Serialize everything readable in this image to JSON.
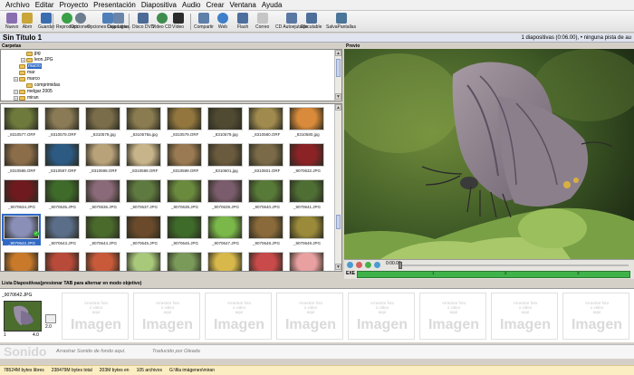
{
  "menu": [
    "Archivo",
    "Editar",
    "Proyecto",
    "Presentación",
    "Diapositiva",
    "Audio",
    "Crear",
    "Ventana",
    "Ayuda"
  ],
  "toolbar": [
    {
      "label": "Nuevo",
      "icon": "new-icon",
      "color": "#8a6fb0"
    },
    {
      "label": "Abrir",
      "icon": "open-icon",
      "color": "#c9a53a"
    },
    {
      "label": "Guardar",
      "icon": "save-icon",
      "color": "#3a6db0"
    },
    {
      "label": "Reproducir",
      "icon": "play-icon",
      "color": "#3aa047"
    },
    {
      "label": "Opciones",
      "icon": "options-icon",
      "color": "#6c7d8f"
    },
    {
      "label": "Opciones Diapositiva",
      "icon": "slide-options-icon",
      "color": "#4f7fb8"
    },
    {
      "label": "Caja Ligera",
      "icon": "lightbox-icon",
      "color": "#6a85a8"
    },
    {
      "label": "Disco DVD",
      "icon": "dvd-icon",
      "color": "#4c6a96"
    },
    {
      "label": "Video CD",
      "icon": "vcd-icon",
      "color": "#3e8d4f"
    },
    {
      "label": "Vídeo",
      "icon": "video-icon",
      "color": "#2b2b2b"
    },
    {
      "label": "Compartir",
      "icon": "share-icon",
      "color": "#5d7faa"
    },
    {
      "label": "Web",
      "icon": "web-icon",
      "color": "#3d7fc9"
    },
    {
      "label": "Flash",
      "icon": "flash-icon",
      "color": "#4d6f9e"
    },
    {
      "label": "Correo",
      "icon": "mail-icon",
      "color": "#c5c5c5"
    },
    {
      "label": "CD Autoejutable",
      "icon": "autorun-cd-icon",
      "color": "#5a78a3"
    },
    {
      "label": "Ejecutable",
      "icon": "executable-icon",
      "color": "#4e6f99"
    },
    {
      "label": "SalvaPantallas",
      "icon": "screensaver-icon",
      "color": "#4b7599"
    }
  ],
  "project": {
    "title": "Sin Título 1",
    "info": "1 diapositivas (0:06.00), • ninguna pista de au"
  },
  "panels": {
    "folders": "Carpetas",
    "preview": "Previo",
    "slide_list": "Lista Diapositivas(presionar TAB para alternar en modo objetivo)"
  },
  "folder_tree": [
    {
      "label": "jpg",
      "indent": 2,
      "expander": ""
    },
    {
      "label": "leon.JPG",
      "indent": 2,
      "expander": "+"
    },
    {
      "label": "macro",
      "indent": 1,
      "expander": "",
      "selected": true
    },
    {
      "label": "mar",
      "indent": 1,
      "expander": ""
    },
    {
      "label": "marco",
      "indent": 1,
      "expander": "+"
    },
    {
      "label": "comprimidas",
      "indent": 2,
      "expander": ""
    },
    {
      "label": "melgar 2005",
      "indent": 1,
      "expander": "+"
    },
    {
      "label": "miran",
      "indent": 1,
      "expander": "+"
    }
  ],
  "thumbnails": [
    {
      "name": "_8310577.ORF",
      "color": "#6d7a3c"
    },
    {
      "name": "_8310578.ORF",
      "color": "#8a7a55"
    },
    {
      "name": "_8310578.jpg",
      "color": "#7a6d4a"
    },
    {
      "name": "_8310578a.jpg",
      "color": "#8a7c50"
    },
    {
      "name": "_8310579.ORF",
      "color": "#92763e"
    },
    {
      "name": "_8310579.jpg",
      "color": "#504a32"
    },
    {
      "name": "_8310580.ORF",
      "color": "#a08a4e"
    },
    {
      "name": "_8310580.jpg",
      "color": "#d98a3a"
    },
    {
      "name": "_8310586.ORF",
      "color": "#8c6d4a"
    },
    {
      "name": "_8310597.ORF",
      "color": "#2c5a82"
    },
    {
      "name": "_8310598.ORF",
      "color": "#b8a27a"
    },
    {
      "name": "_8310598.ORF",
      "color": "#c8b48a"
    },
    {
      "name": "_8310599.ORF",
      "color": "#9a7a52"
    },
    {
      "name": "_8310601.jpg",
      "color": "#6a5a3e"
    },
    {
      "name": "_8310601.ORF",
      "color": "#7a6a48"
    },
    {
      "name": "_9070632.JPG",
      "color": "#8a2226"
    },
    {
      "name": "_9070634.JPG",
      "color": "#6e1a1e"
    },
    {
      "name": "_9070635.JPG",
      "color": "#3e6b2a"
    },
    {
      "name": "_9070636.JPG",
      "color": "#8a6a78"
    },
    {
      "name": "_9070637.JPG",
      "color": "#5f7a40"
    },
    {
      "name": "_9070638.JPG",
      "color": "#6a8a3e"
    },
    {
      "name": "_9070639.JPG",
      "color": "#7a5c6c"
    },
    {
      "name": "_9070640.JPG",
      "color": "#587a38"
    },
    {
      "name": "_9070641.JPG",
      "color": "#4e6e34"
    },
    {
      "name": "_9070642.JPG",
      "color": "#8a8fb8",
      "selected": true
    },
    {
      "name": "_9070643.JPG",
      "color": "#5a6e8a"
    },
    {
      "name": "_9070644.JPG",
      "color": "#4a6a2c"
    },
    {
      "name": "_9070645.JPG",
      "color": "#6a4a2a"
    },
    {
      "name": "_9070646.JPG",
      "color": "#3e6a2a"
    },
    {
      "name": "_9070647.JPG",
      "color": "#7ab84a"
    },
    {
      "name": "_9070648.JPG",
      "color": "#8a6a3a"
    },
    {
      "name": "_9070649.JPG",
      "color": "#9a8a3a"
    },
    {
      "name": "",
      "color": "#c87a2a"
    },
    {
      "name": "",
      "color": "#b84a3a"
    },
    {
      "name": "",
      "color": "#c85a3a"
    },
    {
      "name": "",
      "color": "#a8c87a"
    },
    {
      "name": "",
      "color": "#7a9a5a"
    },
    {
      "name": "",
      "color": "#d8b84a"
    },
    {
      "name": "",
      "color": "#c84a4a"
    },
    {
      "name": "",
      "color": "#e8a0a0"
    }
  ],
  "playback": {
    "time_start": "0:00.00",
    "exe_label": "EXE",
    "ticks": [
      "1",
      "2",
      "3"
    ]
  },
  "slide_strip": {
    "first_slide_name": "_9070642.JPG",
    "duration": "4.0",
    "slide_number": "1",
    "slide_length": "2.0",
    "placeholder_small": "Arrastrar foto\no video\naquí",
    "placeholder_big": "Imagen",
    "empty_slots": 8
  },
  "sound": {
    "big_label": "Sonido",
    "drag_sound": "Arrastrar Sonido de fondo aquí.",
    "translation": "Traducido por Oleada"
  },
  "status": [
    "78524M bytes libres",
    "238479M bytes total",
    "203M bytes en",
    "105 archivos",
    "G:\\fila imágenes\\miran"
  ]
}
